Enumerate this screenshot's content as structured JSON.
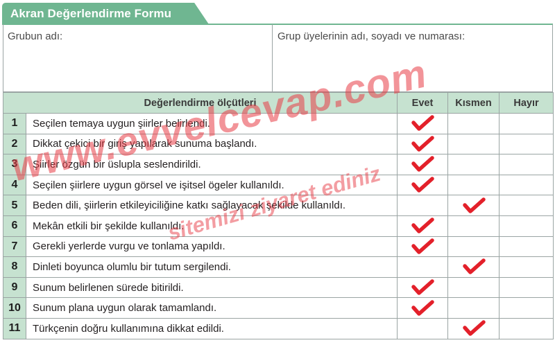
{
  "form": {
    "title": "Akran Değerlendirme Formu",
    "group_name_label": "Grubun adı:",
    "members_label": "Grup üyelerinin adı, soyadı ve numarası:"
  },
  "table": {
    "headers": {
      "criteria": "Değerlendirme ölçütleri",
      "yes": "Evet",
      "partly": "Kısmen",
      "no": "Hayır"
    },
    "rows": [
      {
        "no": "1",
        "text": "Seçilen temaya uygun şiirler belirlendi.",
        "answer": "Evet"
      },
      {
        "no": "2",
        "text": "Dikkat çekici bir giriş yapılarak sunuma başlandı.",
        "answer": "Evet"
      },
      {
        "no": "3",
        "text": "Şiirler özgün bir üslupla seslendirildi.",
        "answer": "Evet"
      },
      {
        "no": "4",
        "text": "Seçilen şiirlere uygun görsel ve işitsel ögeler kullanıldı.",
        "answer": "Evet"
      },
      {
        "no": "5",
        "text": "Beden dili, şiirlerin etkileyiciliğine katkı sağlayacak şekilde kullanıldı.",
        "answer": "Kısmen"
      },
      {
        "no": "6",
        "text": "Mekân etkili bir şekilde kullanıldı.",
        "answer": "Evet"
      },
      {
        "no": "7",
        "text": "Gerekli yerlerde vurgu ve tonlama yapıldı.",
        "answer": "Evet"
      },
      {
        "no": "8",
        "text": "Dinleti boyunca olumlu bir tutum sergilendi.",
        "answer": "Kısmen"
      },
      {
        "no": "9",
        "text": "Sunum belirlenen sürede bitirildi.",
        "answer": "Evet"
      },
      {
        "no": "10",
        "text": "Sunum plana uygun olarak tamamlandı.",
        "answer": "Evet"
      },
      {
        "no": "11",
        "text": "Türkçenin doğru kullanımına dikkat edildi.",
        "answer": "Kısmen"
      }
    ]
  },
  "watermarks": {
    "main": "www.evvelcevap.com",
    "secondary": "sitemizi ziyaret ediniz"
  },
  "colors": {
    "title_bar": "#6fb691",
    "header_fill": "#c6e2d0",
    "check_mark": "#e3202a",
    "border": "#9aa4a3"
  },
  "icons": {
    "check": "check-icon"
  }
}
